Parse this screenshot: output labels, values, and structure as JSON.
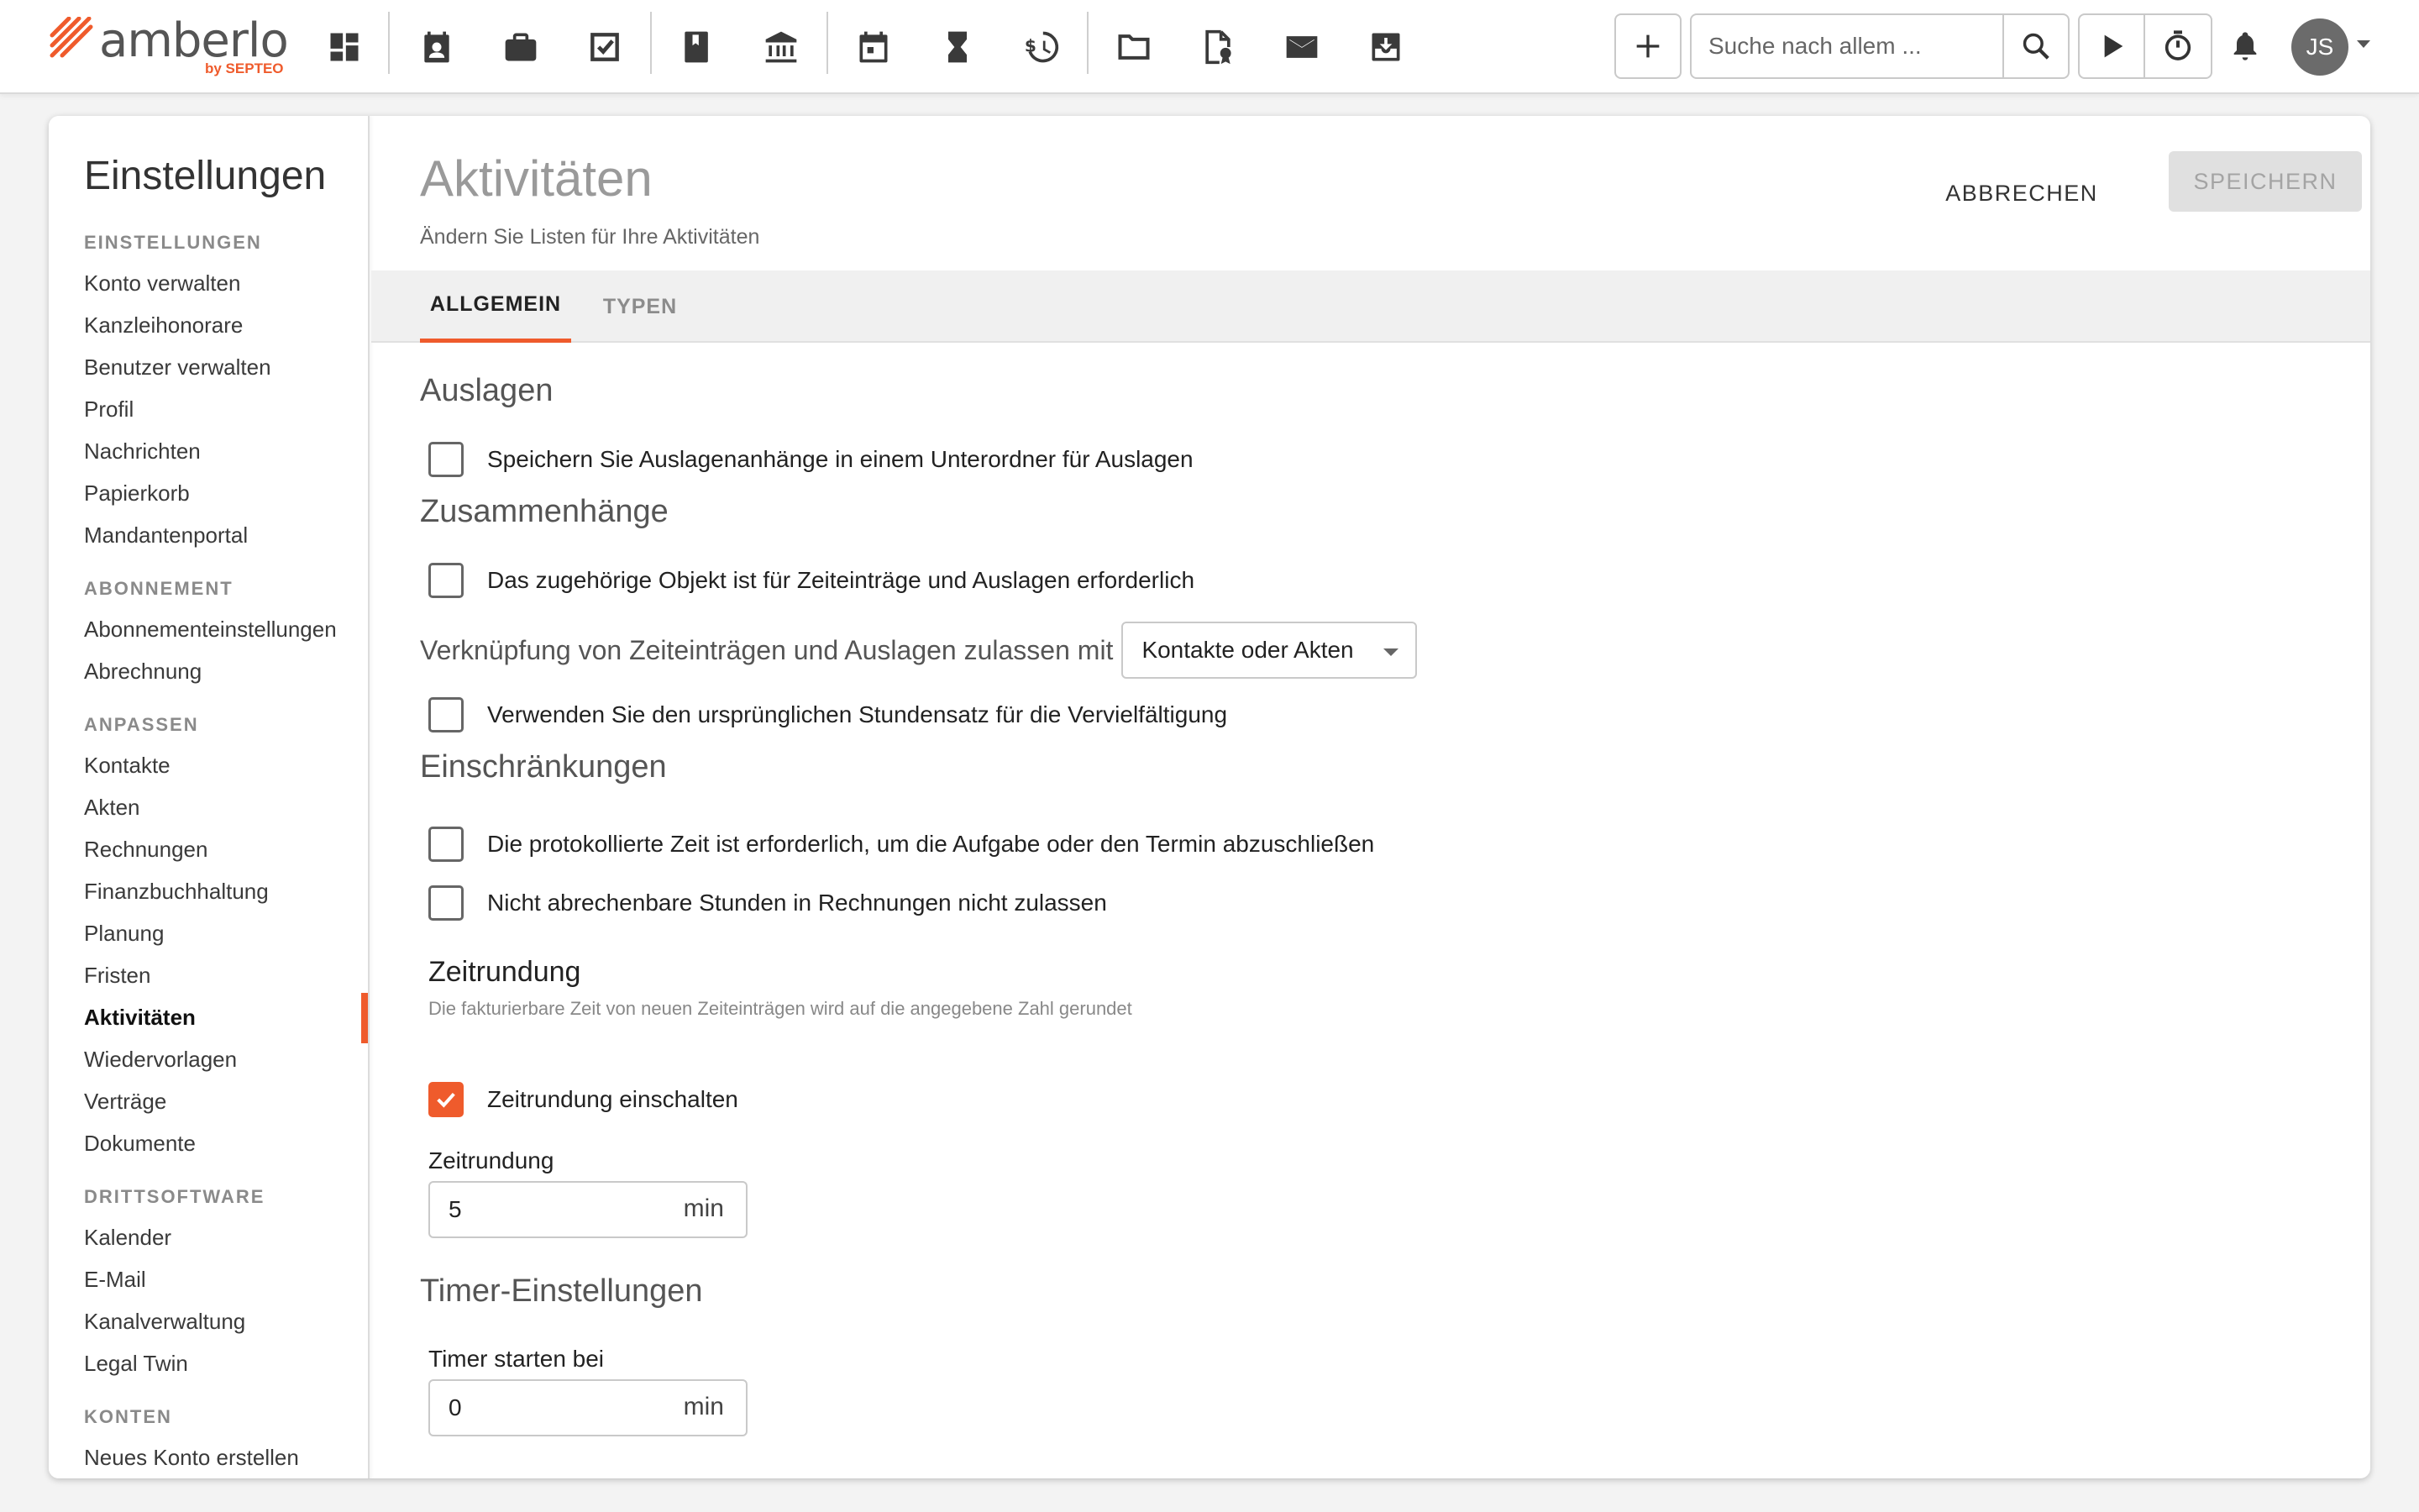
{
  "topbar": {
    "logo_word": "amberlo",
    "logo_by": "by SEPTEO",
    "nav_icons": [
      "dashboard-icon",
      "contacts-icon",
      "briefcase-icon",
      "tasks-icon",
      "book-icon",
      "bank-icon",
      "calendar-icon",
      "hourglass-icon",
      "billing-history-icon",
      "folder-icon",
      "document-seal-icon",
      "mail-icon",
      "inbox-download-icon"
    ],
    "search_placeholder": "Suche nach allem ...",
    "avatar_initials": "JS"
  },
  "sidebar": {
    "title": "Einstellungen",
    "sections": [
      {
        "label": "EINSTELLUNGEN",
        "items": [
          "Konto verwalten",
          "Kanzleihonorare",
          "Benutzer verwalten",
          "Profil",
          "Nachrichten",
          "Papierkorb",
          "Mandantenportal"
        ]
      },
      {
        "label": "ABONNEMENT",
        "items": [
          "Abonnementeinstellungen",
          "Abrechnung"
        ]
      },
      {
        "label": "ANPASSEN",
        "items": [
          "Kontakte",
          "Akten",
          "Rechnungen",
          "Finanzbuchhaltung",
          "Planung",
          "Fristen",
          "Aktivitäten",
          "Wiedervorlagen",
          "Verträge",
          "Dokumente"
        ]
      },
      {
        "label": "DRITTSOFTWARE",
        "items": [
          "Kalender",
          "E-Mail",
          "Kanalverwaltung",
          "Legal Twin"
        ]
      },
      {
        "label": "KONTEN",
        "items": [
          "Neues Konto erstellen"
        ]
      }
    ],
    "active_item": "Aktivitäten"
  },
  "main": {
    "title": "Aktivitäten",
    "subtitle": "Ändern Sie Listen für Ihre Aktivitäten",
    "cancel_label": "ABBRECHEN",
    "save_label": "SPEICHERN",
    "tabs": [
      {
        "label": "ALLGEMEIN",
        "active": true
      },
      {
        "label": "TYPEN",
        "active": false
      }
    ],
    "auslagen": {
      "heading": "Auslagen",
      "cb_subfolder": {
        "label": "Speichern Sie Auslagenanhänge in einem Unterordner für Auslagen",
        "checked": false
      }
    },
    "zusammenhaenge": {
      "heading": "Zusammenhänge",
      "cb_required": {
        "label": "Das zugehörige Objekt ist für Zeiteinträge und Auslagen erforderlich",
        "checked": false
      },
      "link_label": "Verknüpfung von Zeiteinträgen und Auslagen zulassen mit",
      "link_value": "Kontakte oder Akten",
      "cb_rate": {
        "label": "Verwenden Sie den ursprünglichen Stundensatz für die Vervielfältigung",
        "checked": false
      }
    },
    "einschraenkungen": {
      "heading": "Einschränkungen",
      "cb_time_required": {
        "label": "Die protokollierte Zeit ist erforderlich, um die Aufgabe oder den Termin abzuschließen",
        "checked": false
      },
      "cb_nonbillable": {
        "label": "Nicht abrechenbare Stunden in Rechnungen nicht zulassen",
        "checked": false
      }
    },
    "zeitrundung": {
      "heading": "Zeitrundung",
      "hint": "Die fakturierbare Zeit von neuen Zeiteinträgen wird auf die angegebene Zahl gerundet",
      "cb_enable": {
        "label": "Zeitrundung einschalten",
        "checked": true
      },
      "field_label": "Zeitrundung",
      "field_value": "5",
      "unit": "min"
    },
    "timer": {
      "heading": "Timer-Einstellungen",
      "field_label": "Timer starten bei",
      "field_value": "0",
      "unit": "min"
    }
  },
  "colors": {
    "accent": "#ef5b2c",
    "sidebar_active_indicator": "#ef5b2c"
  }
}
